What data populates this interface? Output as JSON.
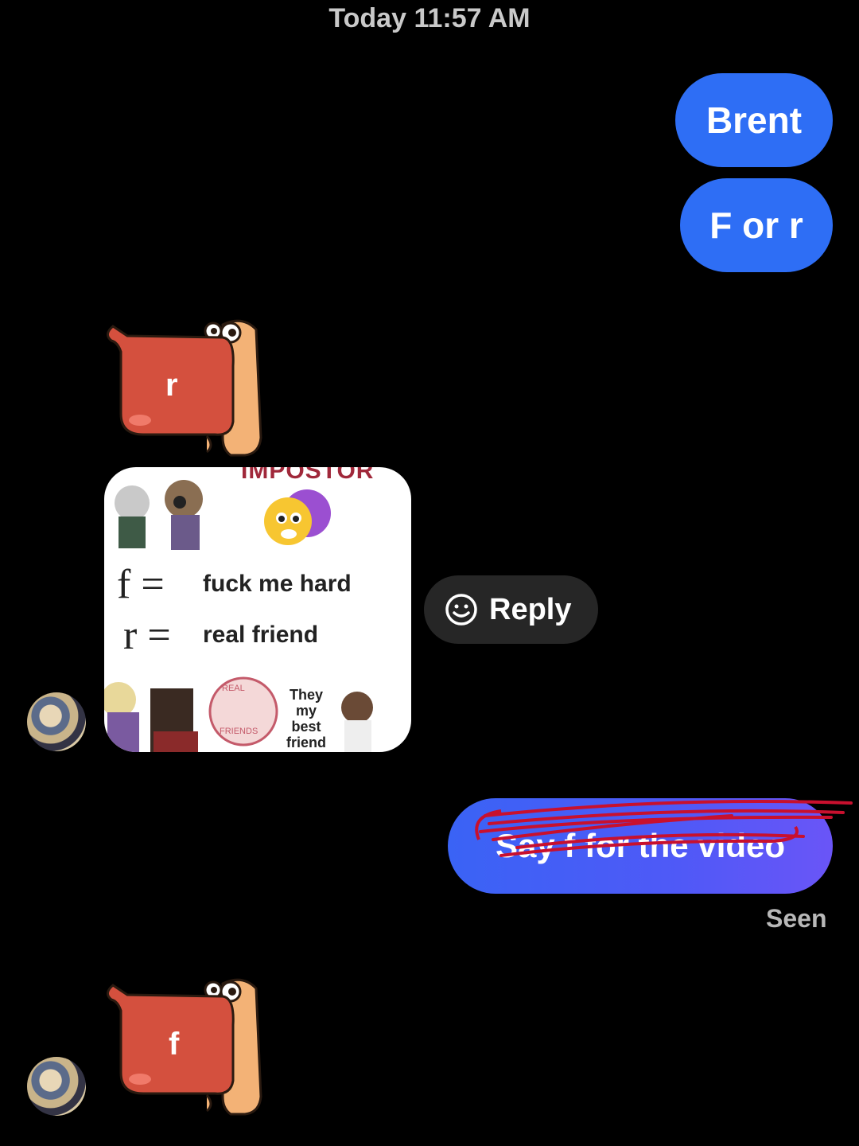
{
  "header": {
    "timestamp": "Today 11:57 AM"
  },
  "messages": {
    "out_1": "Brent",
    "out_2": "F or r",
    "sticker_1_letter": "r",
    "meme": {
      "top_text": "IMPOSTOR",
      "line_f_symbol": "f =",
      "line_f_text": "fuck me hard",
      "line_r_symbol": "r =",
      "line_r_text": "real friend",
      "badge_text_top": "REAL",
      "badge_text_bottom": "FRIENDS",
      "caption": "They my best friend"
    },
    "reply_label": "Reply",
    "out_3": "Say f for the video",
    "status": "Seen",
    "sticker_2_letter": "f"
  },
  "colors": {
    "background": "#000000",
    "outgoing_bubble": "#2e6ef5",
    "sticker_red": "#d4503e",
    "scribble_red": "#c8102e"
  },
  "icons": {
    "reply": "smiley-icon"
  }
}
